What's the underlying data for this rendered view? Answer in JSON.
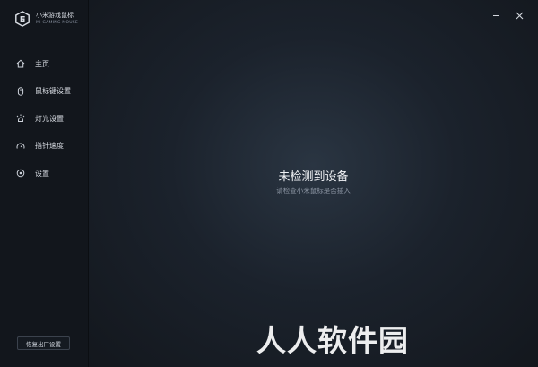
{
  "app": {
    "title": "小米游戏鼠标",
    "subtitle": "MI GAMING MOUSE"
  },
  "sidebar": {
    "items": [
      {
        "label": "主页",
        "icon": "home-icon"
      },
      {
        "label": "鼠标键设置",
        "icon": "mouse-icon"
      },
      {
        "label": "灯光设置",
        "icon": "light-icon"
      },
      {
        "label": "指针速度",
        "icon": "speed-gauge-icon"
      },
      {
        "label": "设置",
        "icon": "settings-icon"
      }
    ],
    "reset_label": "恢复出厂设置"
  },
  "main": {
    "status_title": "未检测到设备",
    "status_subtitle": "请检查小米鼠标是否插入"
  },
  "window_controls": {
    "minimize": "minimize-icon",
    "close": "close-icon"
  },
  "watermark": "人人软件园"
}
